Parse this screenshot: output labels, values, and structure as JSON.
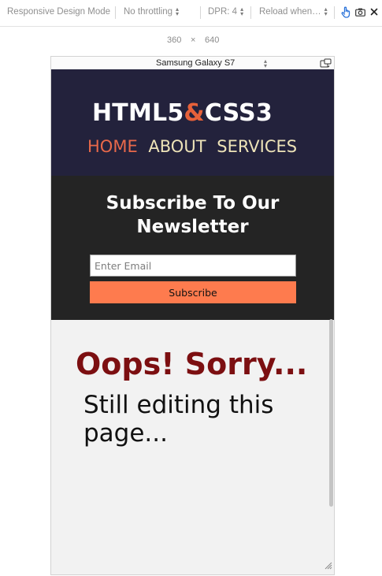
{
  "toolbar": {
    "title": "Responsive Design Mode",
    "throttling": "No throttling",
    "dpr": "DPR: 4",
    "reload": "Reload when…"
  },
  "viewport_size": {
    "width": "360",
    "separator": "×",
    "height": "640"
  },
  "device": {
    "name": "Samsung Galaxy S7"
  },
  "site": {
    "logo_main": "HTML5",
    "logo_amp": "&",
    "logo_tail": "CSS3",
    "nav": [
      "HOME",
      "ABOUT",
      "SERVICES"
    ],
    "newsletter_title": "Subscribe To Our Newsletter",
    "email_placeholder": "Enter Email",
    "subscribe_label": "Subscribe",
    "oops": "Oops! Sorry...",
    "editing": "Still editing this page..."
  },
  "colors": {
    "header_bg": "#23223c",
    "newsletter_bg": "#242424",
    "logo_amp": "#e6613a",
    "nav_text": "#ede3b8",
    "nav_active": "#e8684a",
    "subscribe_bg": "#fe7b4e",
    "oops": "#7c0f11",
    "touch_icon": "#2a72d9"
  },
  "icons": [
    "touch-simulation-icon",
    "screenshot-icon",
    "close-icon",
    "rotate-device-icon",
    "resize-grip-icon"
  ]
}
